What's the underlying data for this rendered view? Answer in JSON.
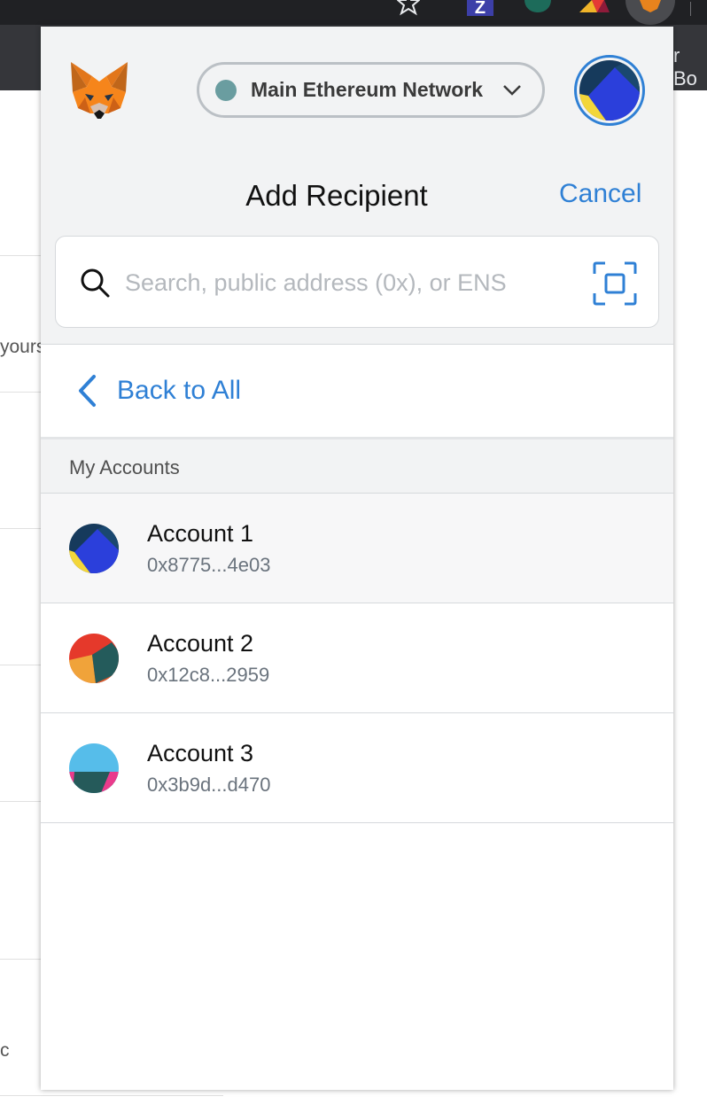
{
  "browser": {
    "tab_text_fragment": "r Bo",
    "extension_z_label": "Z"
  },
  "background_page": {
    "text_fragment_1": "yours",
    "text_fragment_2": "c"
  },
  "header": {
    "network": {
      "label": "Main Ethereum Network",
      "status_color": "#6a9da0"
    },
    "title": "Add Recipient",
    "cancel_label": "Cancel"
  },
  "search": {
    "placeholder": "Search, public address (0x), or ENS",
    "value": ""
  },
  "back_link": {
    "label": "Back to All"
  },
  "accounts_section": {
    "label": "My Accounts",
    "items": [
      {
        "name": "Account 1",
        "address": "0x8775...4e03"
      },
      {
        "name": "Account 2",
        "address": "0x12c8...2959"
      },
      {
        "name": "Account 3",
        "address": "0x3b9d...d470"
      }
    ]
  },
  "colors": {
    "accent": "#2f80d5",
    "header_bg": "#f2f3f4",
    "placeholder": "#b4b8bd"
  },
  "icons": [
    "star-icon",
    "metamask-fox-icon",
    "chevron-down-icon",
    "search-icon",
    "qr-scan-icon",
    "chevron-left-icon"
  ]
}
